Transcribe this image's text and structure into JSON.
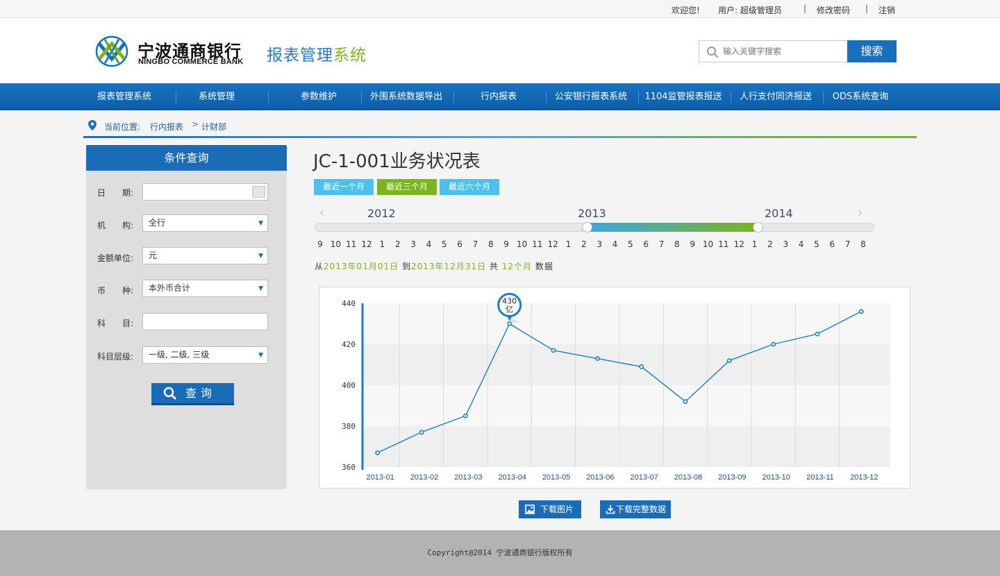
{
  "topbar": {
    "welcome": "欢迎您!",
    "user": "用户: 超级管理员",
    "change_password": "修改密码",
    "logout": "注销"
  },
  "header": {
    "bank_name_cn": "宁波通商银行",
    "bank_name_en": "NINGBO COMMERCE BANK",
    "system_title_part1": "报表管理",
    "system_title_part2": "系统",
    "search_placeholder": "输入关键字搜索",
    "search_button": "搜索"
  },
  "nav": {
    "items": [
      "报表管理系统",
      "系统管理",
      "参数维护",
      "外围系统数据导出",
      "行内报表",
      "公安银行报表系统",
      "1104监管报表报送",
      "人行支付同济报送",
      "ODS系统查询"
    ]
  },
  "breadcrumb": {
    "label": "当前位置:",
    "level1": "行内报表",
    "arrow": ">",
    "level2": "计财部"
  },
  "filter_panel": {
    "title": "条件查询",
    "date_label": "日　　期:",
    "date_value": "",
    "org_label": "机　　构:",
    "org_value": "全行",
    "unit_label": "金额单位:",
    "unit_value": "元",
    "currency_label": "币　　种:",
    "currency_value": "本外币合计",
    "subject_label": "科　　目:",
    "subject_value": "",
    "level_label": "科目层级:",
    "level_value": "一级, 二级, 三级",
    "query_button": "查询"
  },
  "report": {
    "title": "JC-1-001业务状况表",
    "range_buttons": [
      "最近一个月",
      "最近三个月",
      "最近六个月"
    ],
    "active_range": "最近三个月",
    "colors": {
      "range_inactive": "#4cc1ef",
      "range_active": "#7ab51d",
      "line": "#1a7dc0",
      "accent_blue": "#1b6cb6",
      "accent_green": "#7ab51d"
    }
  },
  "timeline": {
    "years": [
      "2012",
      "2013",
      "2014"
    ],
    "months": [
      "9",
      "10",
      "11",
      "12",
      "1",
      "2",
      "3",
      "4",
      "5",
      "6",
      "7",
      "8",
      "9",
      "10",
      "11",
      "12",
      "1",
      "2",
      "3",
      "4",
      "5",
      "6",
      "7",
      "8",
      "9",
      "10",
      "11",
      "12",
      "1",
      "2",
      "3",
      "4",
      "5",
      "6",
      "7",
      "8"
    ],
    "selected_start_index": 16,
    "selected_end_index": 27,
    "info_from": "从",
    "info_start": "2013年01月01日",
    "info_to": "到",
    "info_end": "2013年12月31日",
    "info_total": "共",
    "info_count": "12个月",
    "info_suffix": "数据"
  },
  "chart_data": {
    "type": "line",
    "categories": [
      "2013-01",
      "2013-02",
      "2013-03",
      "2013-04",
      "2013-05",
      "2013-06",
      "2013-07",
      "2013-08",
      "2013-09",
      "2013-10",
      "2013-11",
      "2013-12"
    ],
    "series": [
      {
        "values": [
          367,
          377,
          385,
          430,
          417,
          413,
          409,
          392,
          412,
          420,
          425,
          436
        ]
      }
    ],
    "ylim": [
      360,
      440
    ],
    "yticks": [
      360,
      380,
      400,
      420,
      440
    ],
    "grid": true,
    "annotation": {
      "category": "2013-04",
      "value": 430,
      "label_value": "430",
      "label_unit": "亿"
    }
  },
  "actions": {
    "download_image": "下载图片",
    "download_data": "下载完整数据"
  },
  "footer": {
    "copyright": "Copyright@2014 宁波通商银行版权所有"
  }
}
